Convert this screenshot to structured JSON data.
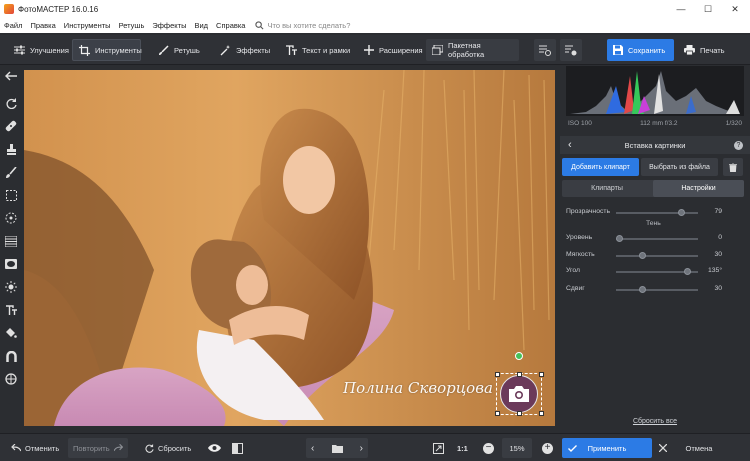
{
  "window": {
    "title": "ФотоМАСТЕР 16.0.16",
    "minimize": "—",
    "maximize": "☐",
    "close": "✕"
  },
  "menu": {
    "items": [
      "Файл",
      "Правка",
      "Инструменты",
      "Ретушь",
      "Эффекты",
      "Вид",
      "Справка"
    ],
    "search_placeholder": "Что вы хотите сделать?"
  },
  "toolbar": {
    "tabs": [
      "Улучшения",
      "Инструменты",
      "Ретушь",
      "Эффекты",
      "Текст и рамки",
      "Расширения"
    ],
    "active_tab": "Инструменты",
    "batch": "Пакетная обработка",
    "save": "Сохранить",
    "print": "Печать"
  },
  "histogram": {
    "iso": "ISO 100",
    "lens": "112 mm f/3.2",
    "shutter": "1/320"
  },
  "panel": {
    "title": "Вставка картинки",
    "add_clipart": "Добавить клипарт",
    "from_file": "Выбрать из файла",
    "tab_cliparts": "Клипарты",
    "tab_settings": "Настройки",
    "params": [
      {
        "label": "Прозрачность",
        "value": "79",
        "pos": 0.79
      },
      {
        "section": "Тень"
      },
      {
        "label": "Уровень",
        "value": "0",
        "pos": 0.0
      },
      {
        "label": "Мягкость",
        "value": "30",
        "pos": 0.3
      },
      {
        "label": "Угол",
        "value": "135°",
        "pos": 0.87
      },
      {
        "label": "Сдвиг",
        "value": "30",
        "pos": 0.3
      }
    ],
    "reset_all": "Сбросить все",
    "apply": "Применить",
    "cancel": "Отмена"
  },
  "watermark": {
    "text": "Полина Скворцова"
  },
  "bottom": {
    "undo": "Отменить",
    "redo": "Повторить",
    "reset": "Сбросить",
    "ratio": "1:1",
    "zoom": "15%"
  },
  "colors": {
    "accent": "#2c7be5",
    "bg": "#2b2d31"
  }
}
